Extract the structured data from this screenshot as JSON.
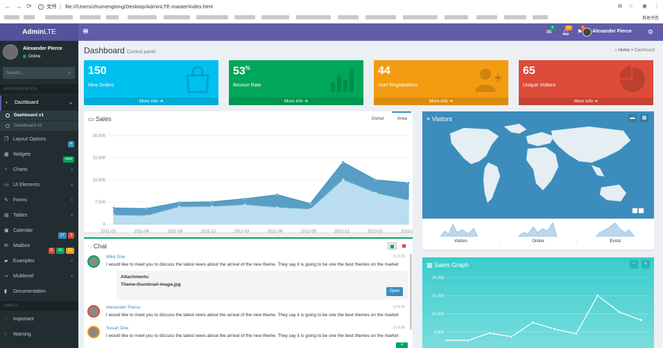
{
  "browser": {
    "file_label": "文件",
    "url": "file:///Users/zhumengtong/Desktop/AdminLTE-master/index.html",
    "other_bookmarks": "其他书签"
  },
  "header": {
    "logo_bold": "Admin",
    "logo_rest": "LTE",
    "user_name": "Alexander Pierce",
    "badges": {
      "messages": "4",
      "notifications": "10",
      "tasks": "9"
    },
    "badge_colors": {
      "messages": "#00a65a",
      "notifications": "#f39c12",
      "tasks": "#dd4b39"
    }
  },
  "sidebar": {
    "user_name": "Alexander Pierce",
    "status": "Online",
    "search_placeholder": "Search...",
    "main_nav_heading": "MAIN NAVIGATION",
    "items": [
      {
        "label": "Dashboard",
        "icon": "dashboard-icon"
      },
      {
        "label": "Dashboard v1"
      },
      {
        "label": "Dashboard v2"
      },
      {
        "label": "Layout Options",
        "badge": "4"
      },
      {
        "label": "Widgets",
        "badge": "new"
      },
      {
        "label": "Charts",
        "icon": "pie-chart-icon"
      },
      {
        "label": "UI Elements",
        "icon": "laptop-icon"
      },
      {
        "label": "Forms",
        "icon": "edit-icon"
      },
      {
        "label": "Tables",
        "icon": "table-icon"
      },
      {
        "label": "Calendar",
        "badges": [
          "17",
          "3"
        ]
      },
      {
        "label": "Mailbox",
        "badges": [
          "5",
          "16",
          "12"
        ]
      },
      {
        "label": "Examples",
        "icon": "folder-icon"
      },
      {
        "label": "Multilevel",
        "icon": "share-icon"
      },
      {
        "label": "Documentation",
        "icon": "book-icon"
      }
    ],
    "labels_heading": "LABELS",
    "labels": [
      {
        "label": "Important",
        "color": "#dd4b39"
      },
      {
        "label": "Warning",
        "color": "#f39c12"
      }
    ]
  },
  "page": {
    "title": "Dashboard",
    "subtitle": "Control panel",
    "breadcrumb_home": "Home",
    "breadcrumb_current": "Dashboard"
  },
  "info_boxes": [
    {
      "value": "150",
      "suffix": "",
      "label": "New Orders",
      "more": "More info",
      "color": "#00c0ef",
      "icon": "shopping-bag-icon"
    },
    {
      "value": "53",
      "suffix": "%",
      "label": "Bounce Rate",
      "more": "More info",
      "color": "#00a65a",
      "icon": "bar-chart-icon"
    },
    {
      "value": "44",
      "suffix": "",
      "label": "User Registrations",
      "more": "More info",
      "color": "#f39c12",
      "icon": "user-plus-icon"
    },
    {
      "value": "65",
      "suffix": "",
      "label": "Unique Visitors",
      "more": "More info",
      "color": "#dd4b39",
      "icon": "pie-chart-icon"
    }
  ],
  "sales": {
    "title": "Sales",
    "tab_donut": "Donut",
    "tab_area": "Area"
  },
  "visitors": {
    "title": "Visitors",
    "sparklines": [
      "Visitors",
      "Online",
      "Exists"
    ]
  },
  "chat": {
    "title": "Chat",
    "messages": [
      {
        "name": "Mike Doe",
        "time": "2:15",
        "text": "I would like to meet you to discuss the latest news about the arrival of the new theme. They say it is going to be one the best themes on the market"
      },
      {
        "name": "Alexander Pierce",
        "time": "5:15",
        "text": "I would like to meet you to discuss the latest news about the arrival of the new theme. They say it is going to be one the best themes on the market"
      },
      {
        "name": "Susan Doe",
        "time": "5:30",
        "text": "I would like to meet you to discuss the latest news about the arrival of the new theme. They say it is going to be one the best themes on the market"
      }
    ],
    "attachments_label": "Attachments:",
    "attachment_file": "Theme-thumbnail-image.jpg",
    "open_label": "Open"
  },
  "sales_graph": {
    "title": "Sales Graph"
  },
  "chart_data": [
    {
      "type": "area",
      "x": [
        "2011-Q3",
        "2011-Q4",
        "2012-Q1",
        "2012-Q2",
        "2012-Q3",
        "2012-Q4",
        "2013-Q1",
        "2013-Q2",
        "2013-Q3"
      ],
      "xticks": [
        "2011-03",
        "2011-06",
        "2011-09",
        "2011-12",
        "2012-03",
        "2012-06",
        "2012-09",
        "2012-12",
        "2013-03",
        "2013-06"
      ],
      "yticks": [
        "0",
        "7,500",
        "15,000",
        "22,500",
        "30,000"
      ],
      "ylim": [
        0,
        30000
      ],
      "series": [
        {
          "values": [
            5500,
            5300,
            7400,
            7600,
            8600,
            10000,
            7000,
            21000,
            15000,
            14000
          ],
          "color": "#3c8dbc"
        },
        {
          "values": [
            3000,
            2800,
            5800,
            5900,
            6500,
            5600,
            5000,
            15000,
            10500,
            8000
          ],
          "color": "#c1e0f2"
        }
      ]
    },
    {
      "type": "line",
      "yticks": [
        "5,000",
        "10,000",
        "15,000",
        "20,000"
      ],
      "ylim": [
        2500,
        20000
      ],
      "values": [
        2700,
        2700,
        4700,
        3700,
        7600,
        5800,
        4500,
        15000,
        10500,
        8300
      ]
    }
  ],
  "colors": {
    "sidebar": "#222d32",
    "topbar": "#605ca8",
    "logo": "#555299"
  }
}
